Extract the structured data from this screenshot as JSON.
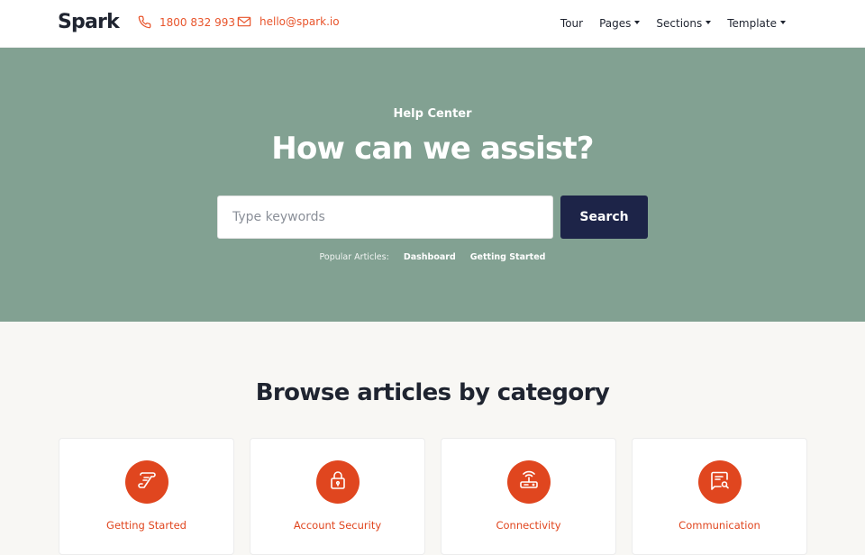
{
  "brand": {
    "name": "Spark"
  },
  "contact": {
    "phone": "1800 832 993",
    "email": "hello@spark.io"
  },
  "nav": {
    "items": [
      {
        "label": "Tour",
        "has_dropdown": false
      },
      {
        "label": "Pages",
        "has_dropdown": true
      },
      {
        "label": "Sections",
        "has_dropdown": true
      },
      {
        "label": "Template",
        "has_dropdown": true
      }
    ]
  },
  "hero": {
    "kicker": "Help Center",
    "title": "How can we assist?",
    "search": {
      "placeholder": "Type keywords",
      "value": "",
      "button_label": "Search"
    },
    "popular": {
      "label": "Popular Articles:",
      "links": [
        "Dashboard",
        "Getting Started"
      ]
    }
  },
  "browse": {
    "title": "Browse articles by category",
    "categories": [
      {
        "label": "Getting Started",
        "icon": "scroll-icon"
      },
      {
        "label": "Account Security",
        "icon": "lock-icon"
      },
      {
        "label": "Connectivity",
        "icon": "router-icon"
      },
      {
        "label": "Communication",
        "icon": "chat-search-icon"
      }
    ]
  },
  "colors": {
    "accent": "#e0461f",
    "hero_bg": "#82a192",
    "button_bg": "#1d2448",
    "page_bg": "#f8f7f4"
  }
}
